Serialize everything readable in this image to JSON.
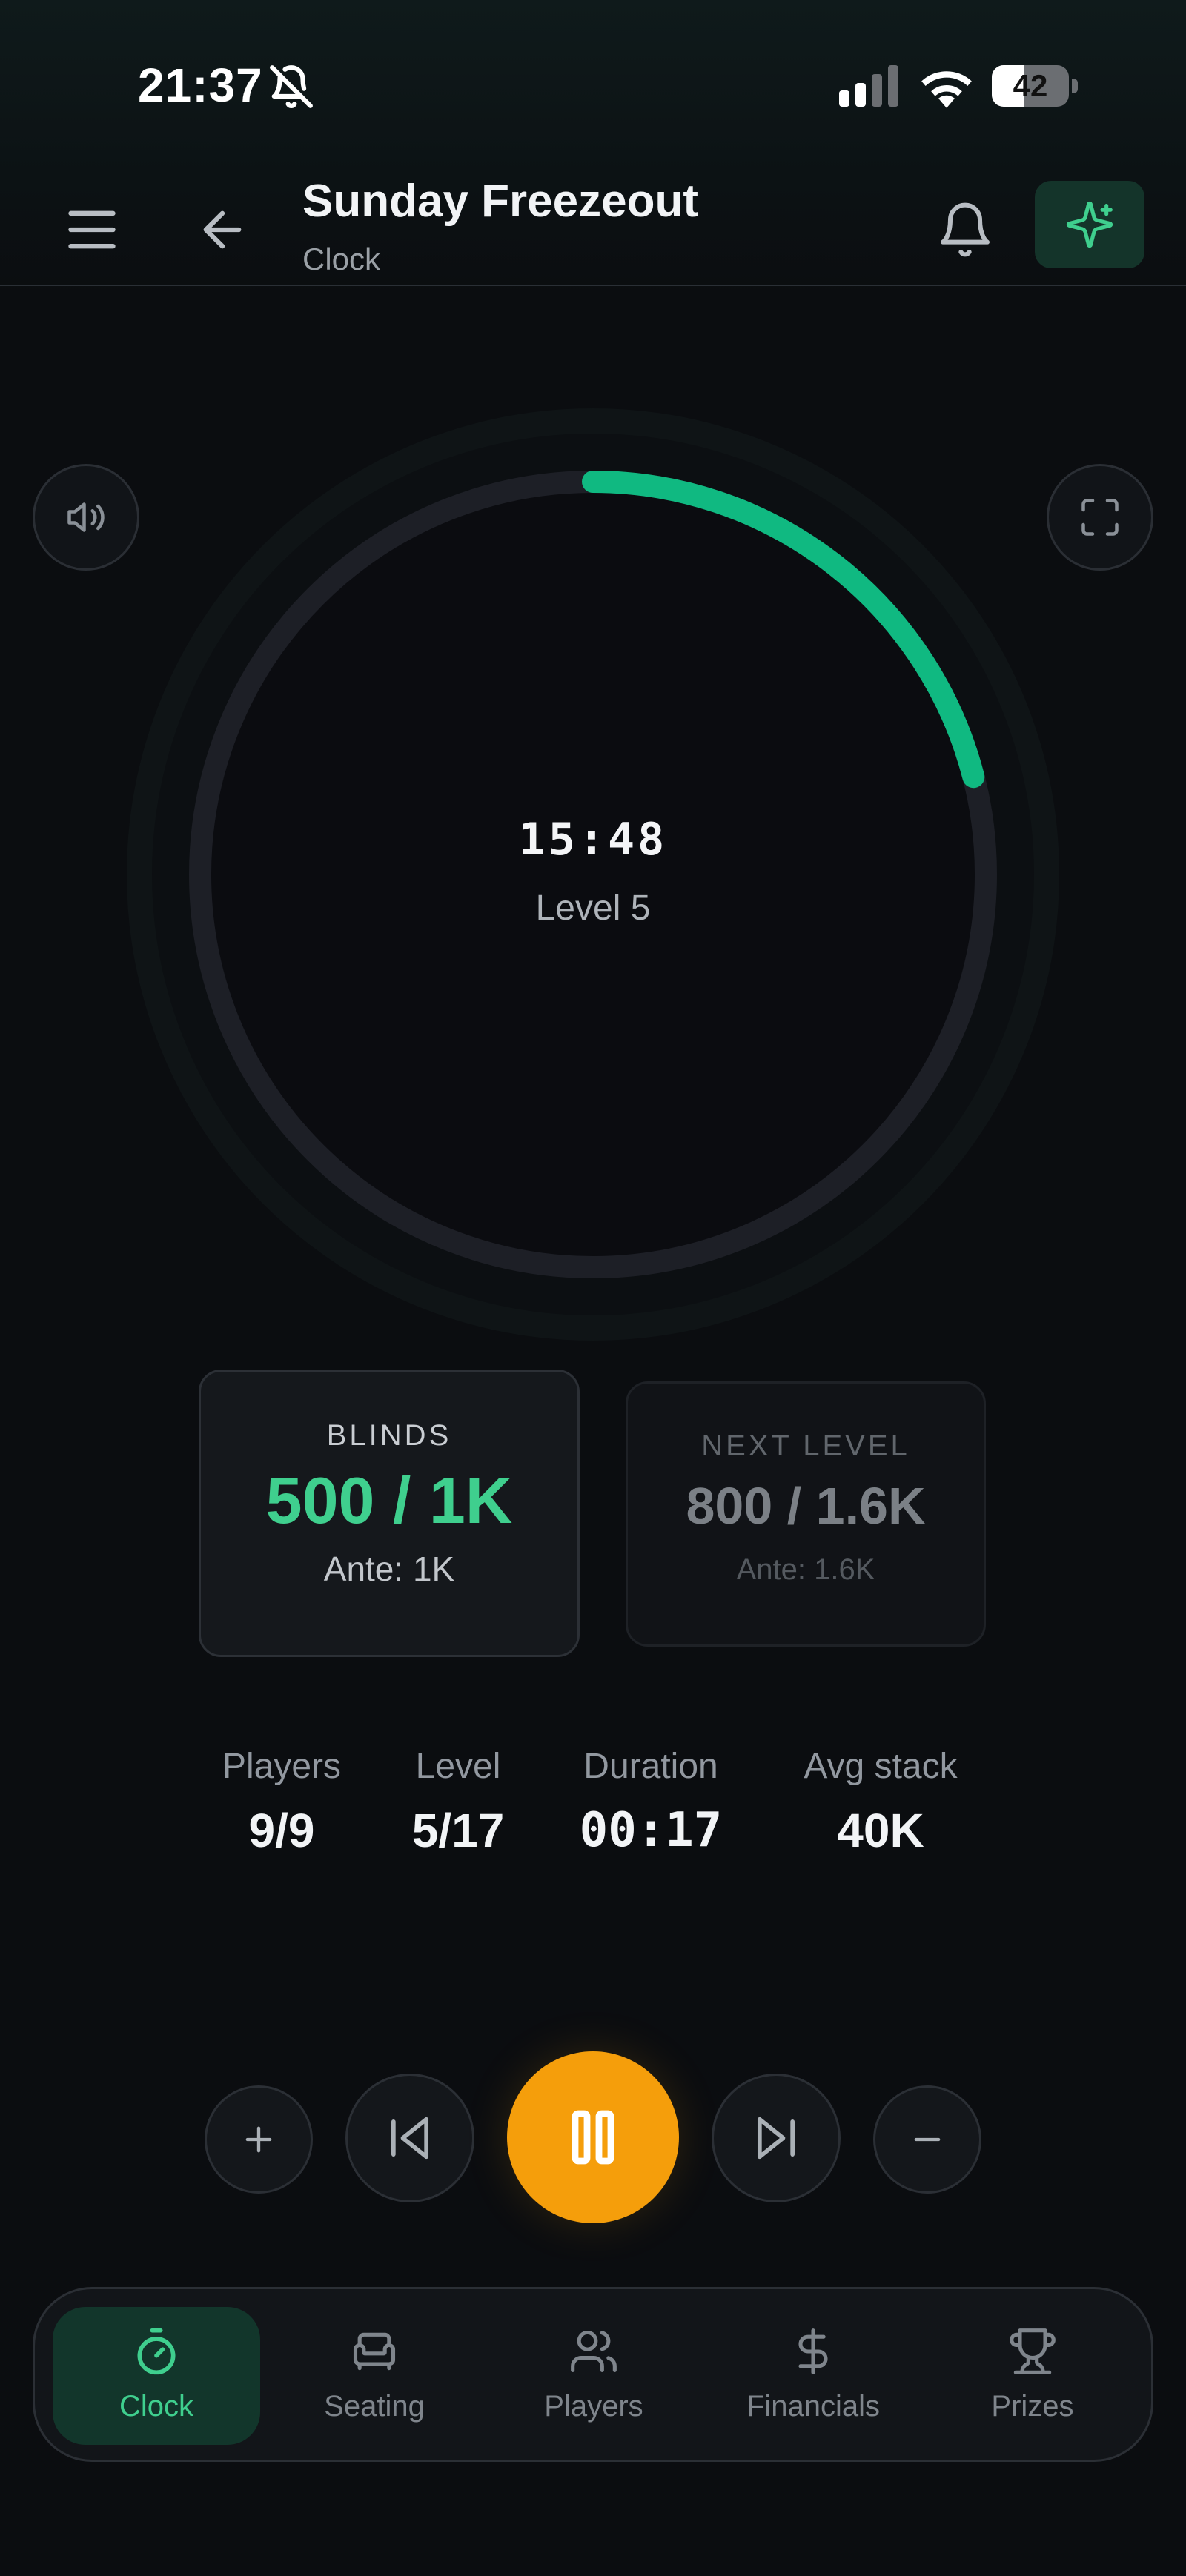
{
  "status_bar": {
    "time": "21:37",
    "battery": "42",
    "battery_level": 0.42,
    "icons": [
      "bell-slash-icon",
      "cellular-signal-icon",
      "wifi-icon",
      "battery-icon"
    ]
  },
  "header": {
    "title": "Sunday Freezeout",
    "subtitle": "Clock",
    "icons": [
      "menu-icon",
      "back-arrow-icon",
      "bell-icon",
      "sparkles-icon"
    ]
  },
  "clock": {
    "time": "15:48",
    "level": "Level 5",
    "progress": 0.21,
    "accent": "#10b981",
    "track": "#1d1f26"
  },
  "blinds": {
    "label": "BLINDS",
    "value": "500 / 1K",
    "ante": "Ante: 1K"
  },
  "next_level": {
    "label": "NEXT LEVEL",
    "value": "800 / 1.6K",
    "ante": "Ante: 1.6K"
  },
  "stats": [
    {
      "label": "Players",
      "value": "9/9"
    },
    {
      "label": "Level",
      "value": "5/17"
    },
    {
      "label": "Duration",
      "value": "00:17"
    },
    {
      "label": "Avg stack",
      "value": "40K"
    }
  ],
  "controls": {
    "icons": [
      "plus-icon",
      "skip-back-icon",
      "pause-icon",
      "skip-forward-icon",
      "minus-icon"
    ],
    "pause_color": "#f59e0b"
  },
  "nav": {
    "items": [
      {
        "label": "Clock",
        "icon": "timer-icon",
        "active": true
      },
      {
        "label": "Seating",
        "icon": "armchair-icon",
        "active": false
      },
      {
        "label": "Players",
        "icon": "users-icon",
        "active": false
      },
      {
        "label": "Financials",
        "icon": "dollar-icon",
        "active": false
      },
      {
        "label": "Prizes",
        "icon": "trophy-icon",
        "active": false
      }
    ]
  }
}
